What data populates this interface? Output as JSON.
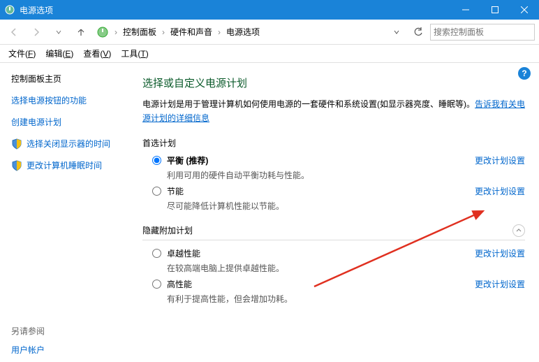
{
  "window": {
    "title": "电源选项"
  },
  "breadcrumb": {
    "items": [
      "控制面板",
      "硬件和声音",
      "电源选项"
    ]
  },
  "search": {
    "placeholder": "搜索控制面板"
  },
  "menubar": {
    "file": "文件(",
    "file_u": "F",
    "file_end": ")",
    "edit": "编辑(",
    "edit_u": "E",
    "edit_end": ")",
    "view": "查看(",
    "view_u": "V",
    "view_end": ")",
    "tools": "工具(",
    "tools_u": "T",
    "tools_end": ")"
  },
  "sidebar": {
    "home": "控制面板主页",
    "items": [
      "选择电源按钮的功能",
      "创建电源计划",
      "选择关闭显示器的时间",
      "更改计算机睡眠时间"
    ],
    "seealso_h": "另请参阅",
    "seealso_items": [
      "用户帐户"
    ]
  },
  "content": {
    "heading": "选择或自定义电源计划",
    "desc_prefix": "电源计划是用于管理计算机如何使用电源的一套硬件和系统设置(如显示器亮度、睡眠等)。",
    "desc_link": "告诉我有关电源计划的详细信息",
    "preferred_h": "首选计划",
    "hide_h": "隐藏附加计划",
    "change_label": "更改计划设置",
    "plans_preferred": [
      {
        "name": "平衡 (推荐)",
        "desc": "利用可用的硬件自动平衡功耗与性能。",
        "selected": true
      },
      {
        "name": "节能",
        "desc": "尽可能降低计算机性能以节能。",
        "selected": false
      }
    ],
    "plans_hidden": [
      {
        "name": "卓越性能",
        "desc": "在较高端电脑上提供卓越性能。",
        "selected": false
      },
      {
        "name": "高性能",
        "desc": "有利于提高性能，但会增加功耗。",
        "selected": false
      }
    ]
  }
}
